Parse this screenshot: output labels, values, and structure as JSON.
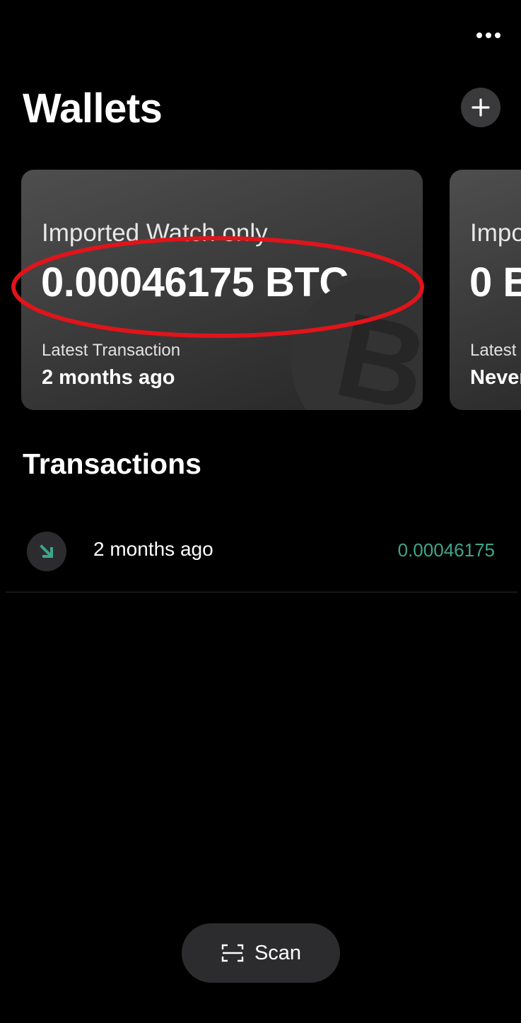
{
  "header": {
    "title": "Wallets",
    "more_icon": "more-horizontal-icon",
    "add_icon": "plus-icon"
  },
  "wallets": [
    {
      "label": "Imported Watch only",
      "balance": "0.00046175 BTC",
      "latest_label": "Latest Transaction",
      "latest_value": "2 months ago",
      "watermark_icon": "bitcoin-icon"
    },
    {
      "label": "Impo",
      "balance": "0 B",
      "latest_label": "Latest",
      "latest_value": "Never"
    }
  ],
  "transactions": {
    "title": "Transactions",
    "items": [
      {
        "icon": "arrow-down-right-icon",
        "date": "2 months ago",
        "amount": "0.00046175"
      }
    ]
  },
  "scan": {
    "label": "Scan",
    "icon": "scan-icon"
  },
  "colors": {
    "background": "#000000",
    "card": "#3c3c3c",
    "accent_green": "#3ea58a",
    "highlight_red": "#e0141b",
    "button_bg": "#2c2c2e"
  }
}
